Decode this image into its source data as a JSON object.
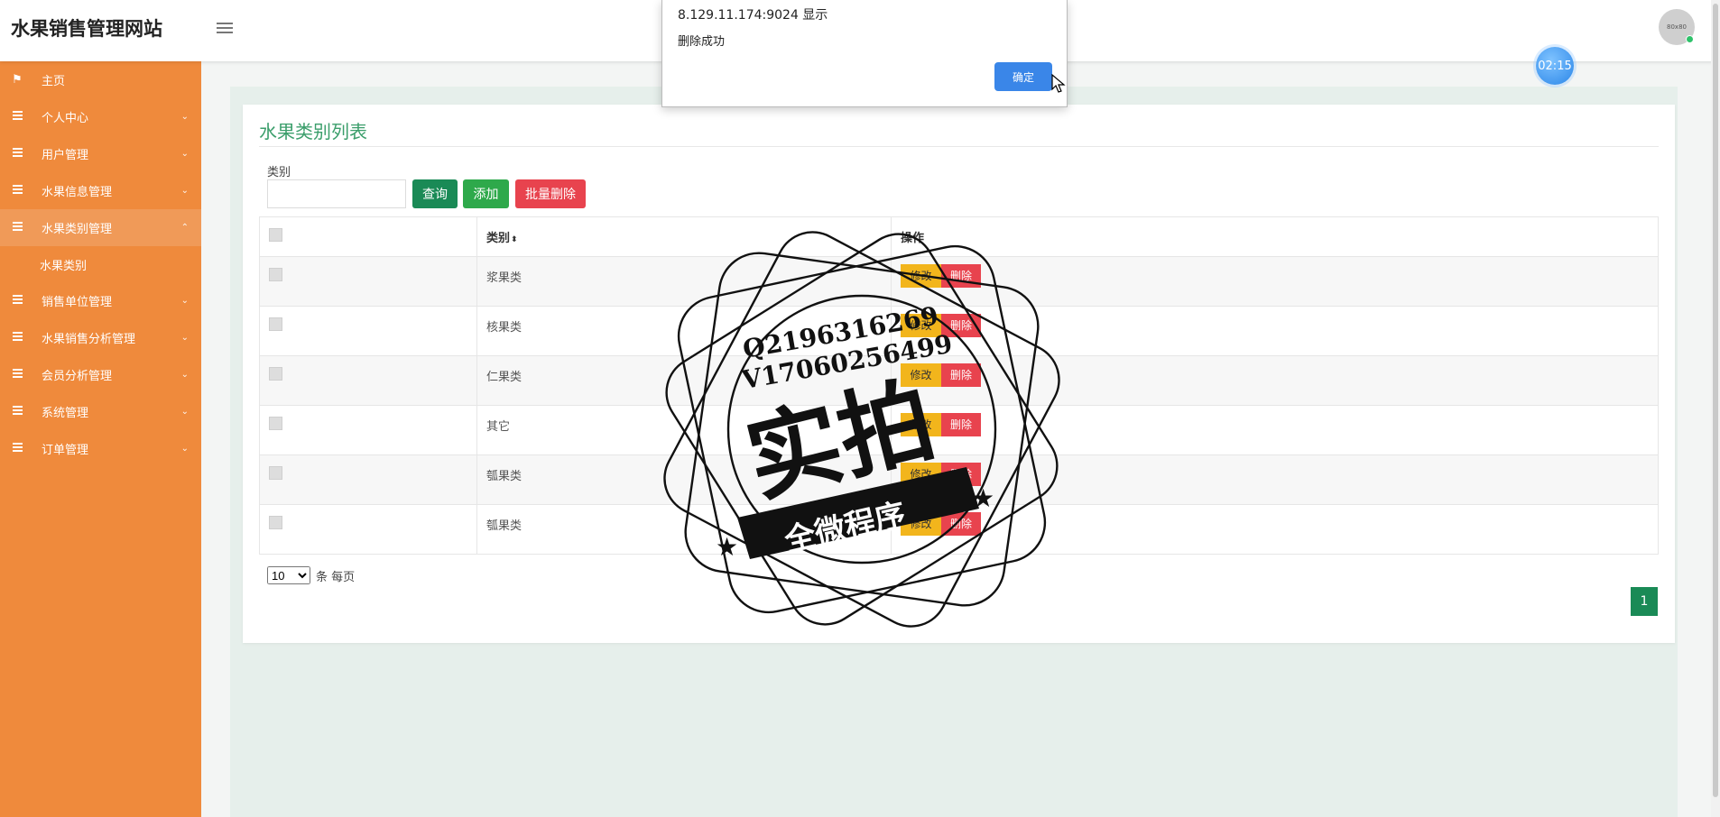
{
  "header": {
    "brand": "水果销售管理网站",
    "avatar_text": "80x80"
  },
  "timer": "02:15",
  "sidebar": {
    "items": [
      {
        "label": "主页",
        "icon": "flag-icon"
      },
      {
        "label": "个人中心",
        "icon": "menu-lines-icon"
      },
      {
        "label": "用户管理",
        "icon": "menu-lines-icon"
      },
      {
        "label": "水果信息管理",
        "icon": "menu-lines-icon"
      },
      {
        "label": "水果类别管理",
        "icon": "menu-lines-icon"
      },
      {
        "label": "销售单位管理",
        "icon": "menu-lines-icon"
      },
      {
        "label": "水果销售分析管理",
        "icon": "menu-lines-icon"
      },
      {
        "label": "会员分析管理",
        "icon": "menu-lines-icon"
      },
      {
        "label": "系统管理",
        "icon": "menu-lines-icon"
      },
      {
        "label": "订单管理",
        "icon": "menu-lines-icon"
      }
    ],
    "sub_item": "水果类别"
  },
  "main": {
    "title": "水果类别列表",
    "filter_label": "类别",
    "filter_value": "",
    "buttons": {
      "query": "查询",
      "add": "添加",
      "batch_delete": "批量删除"
    },
    "table": {
      "headers": [
        "",
        "类别",
        "操作"
      ],
      "sort_icon": "⬍",
      "rows": [
        "浆果类",
        "核果类",
        "仁果类",
        "其它",
        "瓠果类",
        "瓠果类"
      ],
      "edit_label": "修改",
      "delete_label": "删除"
    },
    "page_size": "10",
    "page_size_suffix": "条 每页",
    "current_page": "1"
  },
  "dialog": {
    "origin": "8.129.11.174:9024 显示",
    "message": "删除成功",
    "ok_label": "确定"
  },
  "watermark": {
    "line1": "Q2196316269",
    "line2": "V17060256499",
    "big": "实拍",
    "banner": "全微程序"
  },
  "colors": {
    "sidebar": "#ef8a3c",
    "primary_green": "#1a8a56",
    "title_green": "#3b9e6b",
    "danger": "#e8434e",
    "warning": "#f2b51c",
    "dialog_button": "#3a86e8"
  }
}
